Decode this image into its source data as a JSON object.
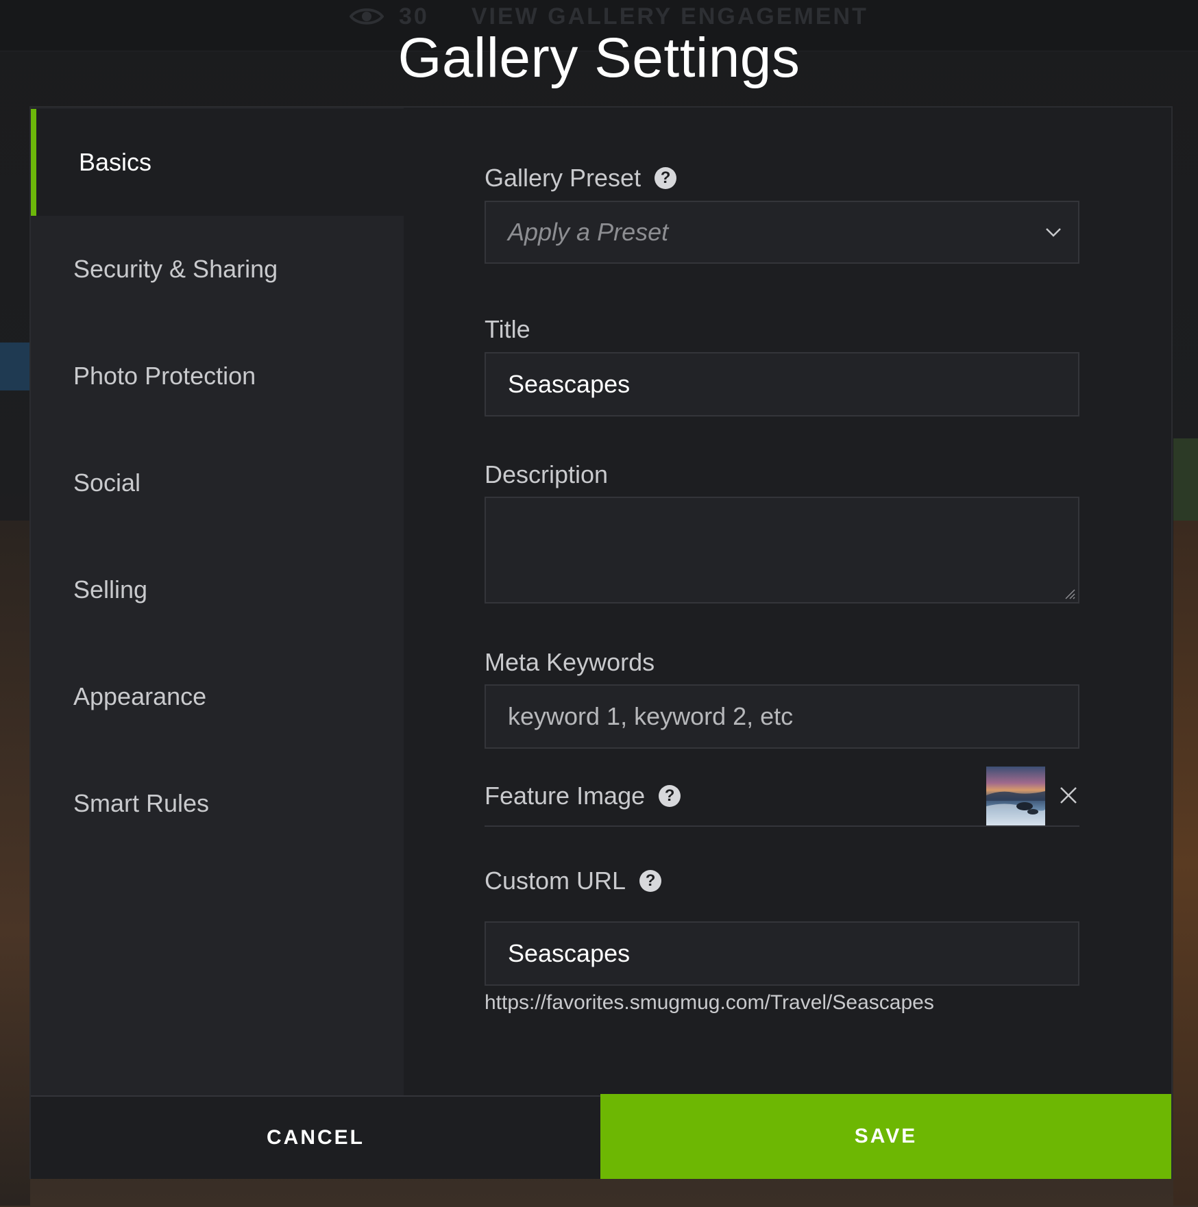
{
  "background": {
    "view_count": "30",
    "engagement_label": "VIEW GALLERY ENGAGEMENT"
  },
  "modal": {
    "title": "Gallery Settings"
  },
  "sidebar": {
    "items": [
      {
        "label": "Basics",
        "active": true
      },
      {
        "label": "Security & Sharing",
        "active": false
      },
      {
        "label": "Photo Protection",
        "active": false
      },
      {
        "label": "Social",
        "active": false
      },
      {
        "label": "Selling",
        "active": false
      },
      {
        "label": "Appearance",
        "active": false
      },
      {
        "label": "Smart Rules",
        "active": false
      }
    ]
  },
  "form": {
    "gallery_preset": {
      "label": "Gallery Preset",
      "placeholder": "Apply a Preset",
      "help_icon": "question-circle-icon"
    },
    "title": {
      "label": "Title",
      "value": "Seascapes"
    },
    "description": {
      "label": "Description",
      "value": ""
    },
    "meta_keywords": {
      "label": "Meta Keywords",
      "placeholder": "keyword 1, keyword 2, etc"
    },
    "feature_image": {
      "label": "Feature Image",
      "help_icon": "question-circle-icon",
      "remove_icon": "close-icon"
    },
    "custom_url": {
      "label": "Custom URL",
      "value": "Seascapes",
      "url_preview": "https://favorites.smugmug.com/Travel/Seascapes",
      "help_icon": "question-circle-icon"
    }
  },
  "footer": {
    "cancel_label": "CANCEL",
    "save_label": "SAVE"
  },
  "colors": {
    "accent": "#6db703",
    "panel": "#1d1e21",
    "sidebar": "#232428",
    "input_bg": "#222327",
    "input_border": "#34353a"
  }
}
